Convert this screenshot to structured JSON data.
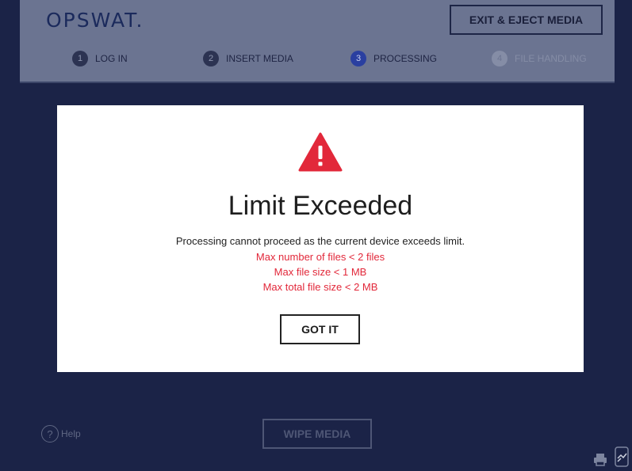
{
  "header": {
    "logo": "OPSWAT",
    "logo_dot": ".",
    "exit_button": "EXIT & EJECT MEDIA",
    "steps": [
      {
        "number": "1",
        "label": "LOG IN",
        "state": "done"
      },
      {
        "number": "2",
        "label": "INSERT MEDIA",
        "state": "done"
      },
      {
        "number": "3",
        "label": "PROCESSING",
        "state": "active"
      },
      {
        "number": "4",
        "label": "FILE HANDLING",
        "state": "disabled"
      }
    ]
  },
  "modal": {
    "icon": "warning-triangle-icon",
    "title": "Limit Exceeded",
    "message": "Processing cannot proceed as the current device exceeds limit.",
    "limits": [
      "Max number of files < 2 files",
      "Max file size < 1 MB",
      "Max total file size < 2 MB"
    ],
    "button": "GOT IT"
  },
  "footer": {
    "help_icon": "?",
    "help_label": "Help",
    "wipe_button": "WIPE MEDIA",
    "icons": [
      "printer-icon",
      "device-scan-icon"
    ]
  },
  "colors": {
    "background": "#1b2347",
    "header_overlay": "#6b7491",
    "alert_red": "#e2283a",
    "active_step": "#2a3fa0"
  }
}
